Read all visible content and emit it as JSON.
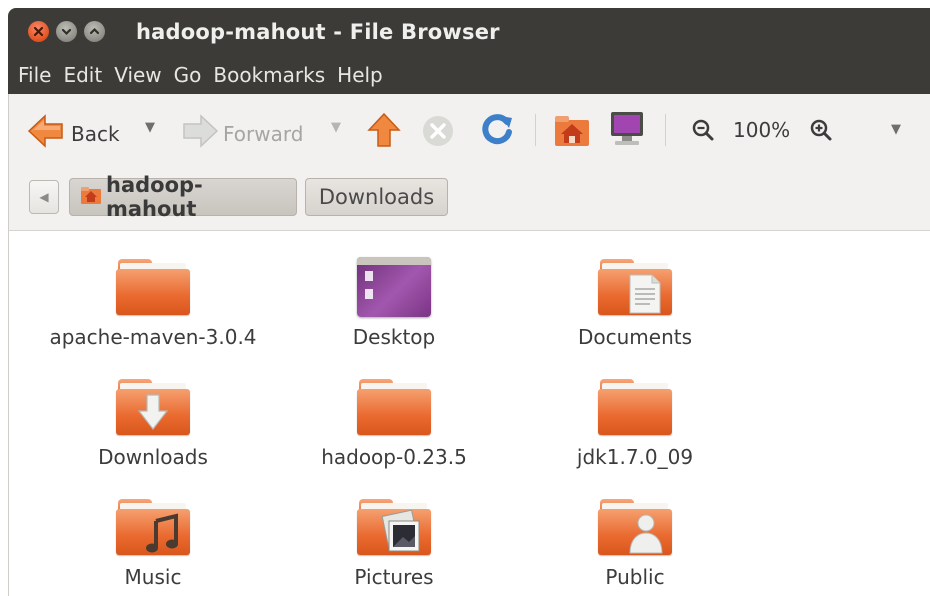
{
  "window": {
    "title": "hadoop-mahout - File Browser",
    "controls": [
      "close-icon",
      "minimize-icon",
      "maximize-icon"
    ]
  },
  "menubar": [
    "File",
    "Edit",
    "View",
    "Go",
    "Bookmarks",
    "Help"
  ],
  "toolbar": {
    "back_label": "Back",
    "forward_label": "Forward",
    "zoom_level": "100%",
    "icons": [
      "back-arrow-icon",
      "forward-arrow-icon",
      "up-arrow-icon",
      "stop-icon",
      "reload-icon",
      "home-icon",
      "computer-icon",
      "zoom-out-icon",
      "zoom-in-icon",
      "dropdown-icon"
    ]
  },
  "pathbar": {
    "crumbs": [
      "hadoop-mahout",
      "Downloads"
    ],
    "active_index": 0
  },
  "files": [
    {
      "name": "apache-maven-3.0.4",
      "icon": "folder-icon"
    },
    {
      "name": "Desktop",
      "icon": "desktop-folder-icon"
    },
    {
      "name": "Documents",
      "icon": "documents-folder-icon"
    },
    {
      "name": "Downloads",
      "icon": "downloads-folder-icon"
    },
    {
      "name": "hadoop-0.23.5",
      "icon": "folder-icon"
    },
    {
      "name": "jdk1.7.0_09",
      "icon": "folder-icon"
    },
    {
      "name": "Music",
      "icon": "music-folder-icon"
    },
    {
      "name": "Pictures",
      "icon": "pictures-folder-icon"
    },
    {
      "name": "Public",
      "icon": "public-folder-icon"
    }
  ],
  "colors": {
    "titlebar": "#3c3b37",
    "folder": "#e9692f",
    "toolbar_bg": "#f2f1f0"
  }
}
